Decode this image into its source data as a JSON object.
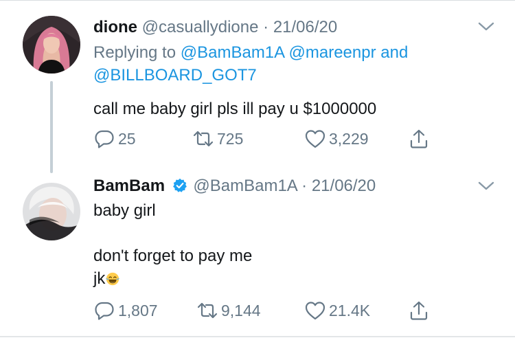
{
  "tweets": [
    {
      "display_name": "dione",
      "handle": "@casuallydione",
      "separator": "·",
      "date": "21/06/20",
      "verified": false,
      "replying_label": "Replying to",
      "reply_mentions": [
        "@BamBam1A",
        "@mareenpr",
        "@BILLBOARD_GOT7"
      ],
      "reply_and": "and",
      "text": "call me baby girl pls ill pay u $1000000",
      "actions": {
        "replies": "25",
        "retweets": "725",
        "likes": "3,229"
      },
      "icons": [
        "reply-icon",
        "retweet-icon",
        "like-icon",
        "share-icon",
        "chevron-down-icon"
      ]
    },
    {
      "display_name": "BamBam",
      "handle": "@BamBam1A",
      "separator": "·",
      "date": "21/06/20",
      "verified": true,
      "text": "baby girl\n\ndon't forget to pay me\njk",
      "emoji": "face-with-tears-of-joy",
      "actions": {
        "replies": "1,807",
        "retweets": "9,144",
        "likes": "21.4K"
      },
      "icons": [
        "verified-badge-icon",
        "reply-icon",
        "retweet-icon",
        "like-icon",
        "share-icon",
        "chevron-down-icon"
      ]
    }
  ],
  "colors": {
    "link": "#1b95e0",
    "secondary": "#657786",
    "text": "#14171a",
    "thread_line": "#c4cfd6",
    "verified": "#1da1f2"
  }
}
